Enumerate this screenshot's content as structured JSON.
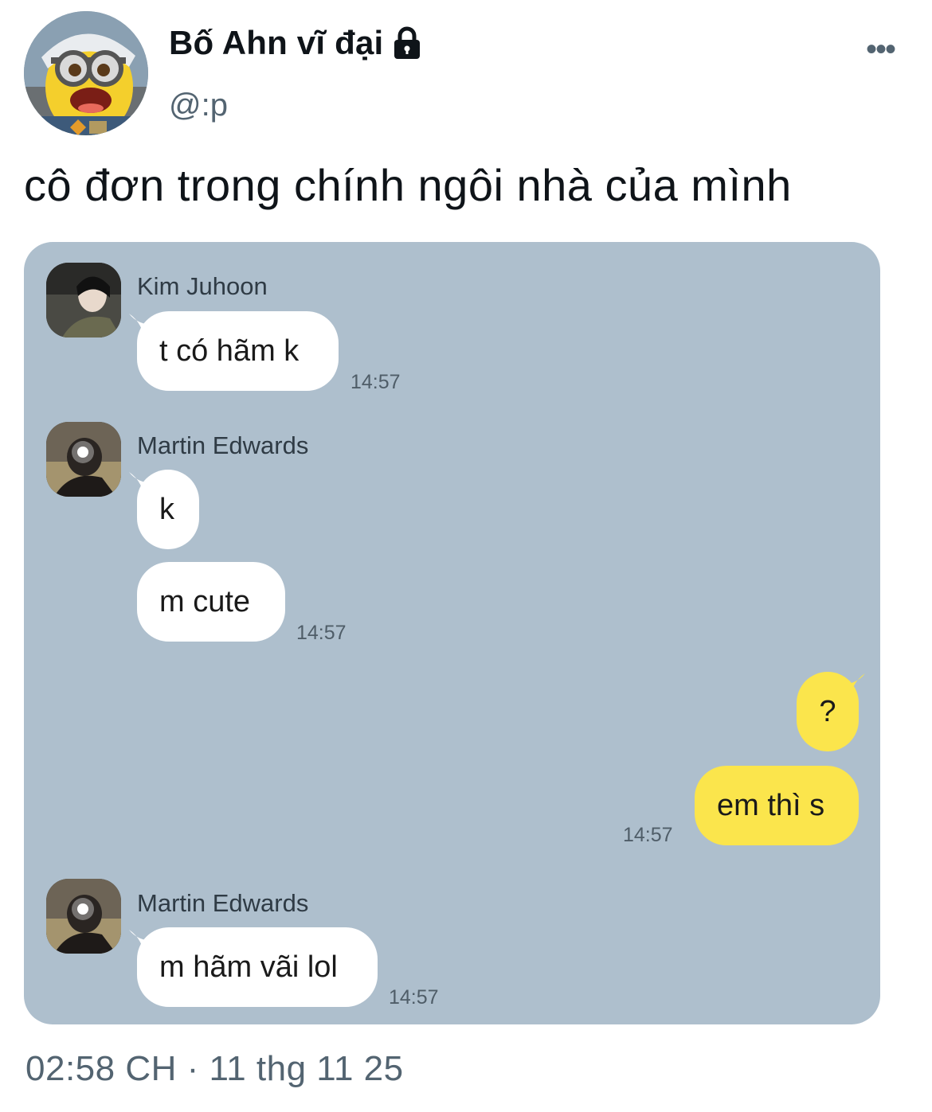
{
  "author": {
    "display_name": "Bố Ahn vĩ đại",
    "handle": "@:p",
    "avatar_icon": "minion-avatar",
    "protected_icon": "lock-icon"
  },
  "more_icon_glyph": "•••",
  "tweet": {
    "text": "cô đơn trong chính ngôi nhà của mình",
    "time": "02:58 CH · 11 thg 11 25"
  },
  "chat": {
    "background": "#aebfcd",
    "incoming_bubble_color": "#ffffff",
    "outgoing_bubble_color": "#fbe54c",
    "groups": [
      {
        "sender": "Kim Juhoon",
        "messages": [
          "t có hãm k"
        ],
        "time": "14:57"
      },
      {
        "sender": "Martin Edwards",
        "messages": [
          "k",
          "m cute"
        ],
        "time": "14:57"
      },
      {
        "sender": "",
        "outgoing": true,
        "messages": [
          "?",
          "em thì s"
        ],
        "time": "14:57"
      },
      {
        "sender": "Martin Edwards",
        "messages": [
          "m hãm vãi lol"
        ],
        "time": "14:57"
      }
    ]
  }
}
